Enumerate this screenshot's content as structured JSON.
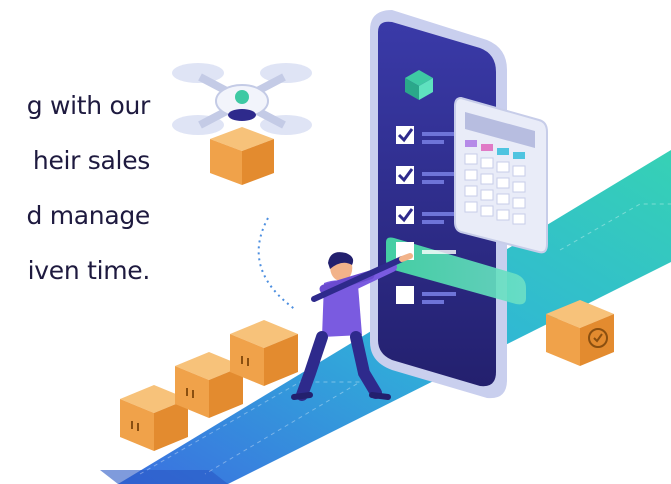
{
  "text_lines": [
    "g with our",
    "heir sales",
    "d manage",
    "iven time."
  ],
  "colors": {
    "text": "#1e1a3f",
    "phone_body": "#2e2a8c",
    "phone_frame": "#e8ebf7",
    "conveyor": "#33b0d6",
    "box": "#f2a54a",
    "check_highlight": "#52d6a6",
    "figure_shirt": "#7a5be0"
  },
  "illustration": {
    "elements": [
      "drone-icon",
      "smartphone",
      "calculator",
      "checklist",
      "conveyor-belt",
      "shipping-box",
      "worker-figure",
      "pencil-icon"
    ]
  }
}
